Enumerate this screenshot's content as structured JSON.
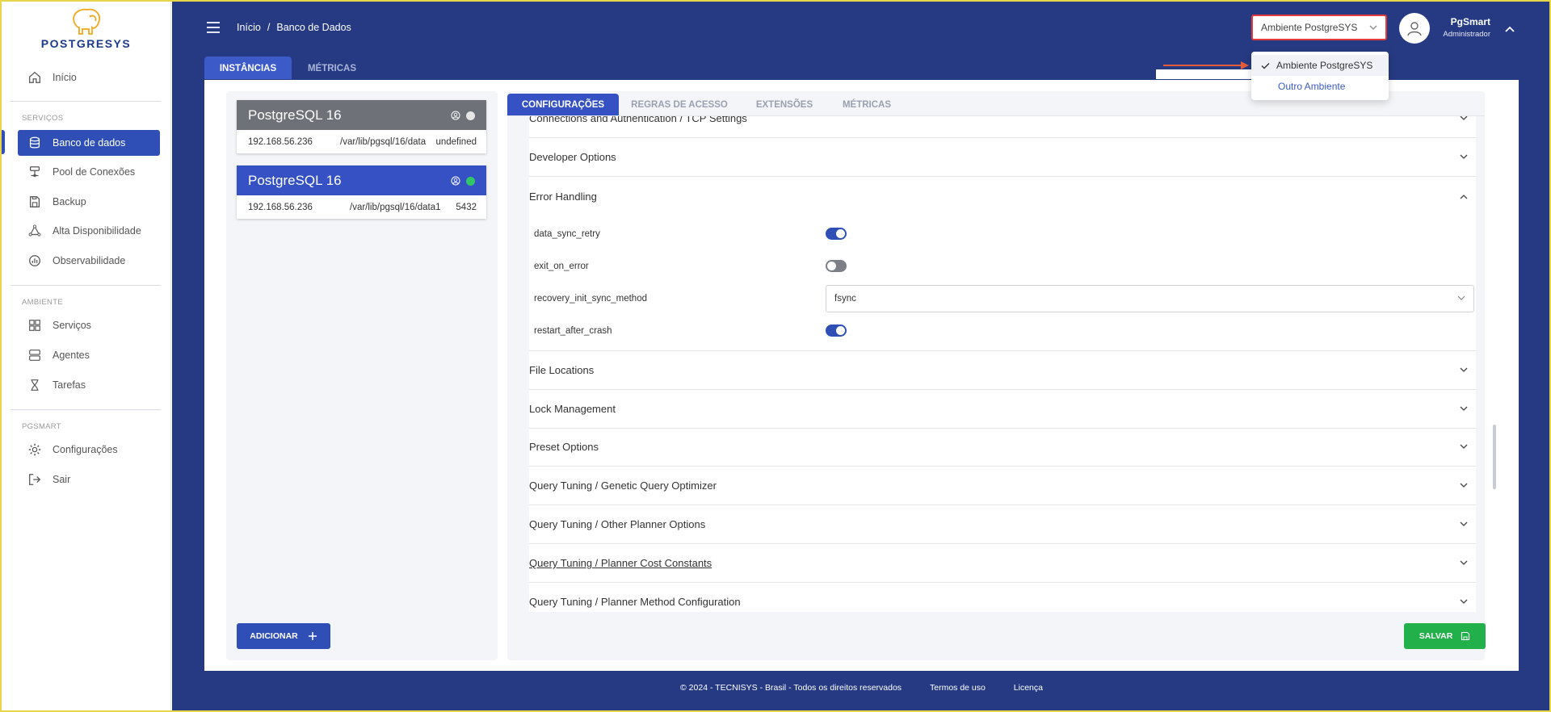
{
  "brand": {
    "name": "POSTGRESYS"
  },
  "sidebar": {
    "items": [
      {
        "label": "Início"
      },
      {
        "label": "Banco de dados"
      },
      {
        "label": "Pool de Conexões"
      },
      {
        "label": "Backup"
      },
      {
        "label": "Alta Disponibilidade"
      },
      {
        "label": "Observabilidade"
      },
      {
        "label": "Serviços"
      },
      {
        "label": "Agentes"
      },
      {
        "label": "Tarefas"
      },
      {
        "label": "Configurações"
      },
      {
        "label": "Sair"
      }
    ],
    "sections": [
      "SERVIÇOS",
      "AMBIENTE",
      "PGSMART"
    ]
  },
  "breadcrumb": {
    "home": "Início",
    "separator": "/",
    "current": "Banco de Dados"
  },
  "top_tabs": [
    {
      "label": "INSTÂNCIAS"
    },
    {
      "label": "MÉTRICAS"
    }
  ],
  "environment": {
    "selected": "Ambiente PostgreSYS",
    "options": [
      "Ambiente PostgreSYS",
      "Outro Ambiente"
    ]
  },
  "user": {
    "name": "PgSmart",
    "role": "Administrador"
  },
  "instances": [
    {
      "title": "PostgreSQL 16",
      "ip": "192.168.56.236",
      "path": "/var/lib/pgsql/16/data",
      "port": "undefined",
      "status_color": "#e6e6e6",
      "header_color": "#6e7178"
    },
    {
      "title": "PostgreSQL 16",
      "ip": "192.168.56.236",
      "path": "/var/lib/pgsql/16/data1",
      "port": "5432",
      "status_color": "#32c766",
      "header_color": "#3551c4"
    }
  ],
  "add_button": {
    "label": "ADICIONAR"
  },
  "config_tabs": [
    {
      "label": "CONFIGURAÇÕES"
    },
    {
      "label": "REGRAS DE ACESSO"
    },
    {
      "label": "EXTENSÕES"
    },
    {
      "label": "MÉTRICAS"
    }
  ],
  "sections": [
    {
      "label": "Connections and Authentication / TCP Settings"
    },
    {
      "label": "Developer Options"
    },
    {
      "label": "Error Handling"
    },
    {
      "label": "File Locations"
    },
    {
      "label": "Lock Management"
    },
    {
      "label": "Preset Options"
    },
    {
      "label": "Query Tuning / Genetic Query Optimizer"
    },
    {
      "label": "Query Tuning / Other Planner Options"
    },
    {
      "label": "Query Tuning / Planner Cost Constants"
    },
    {
      "label": "Query Tuning / Planner Method Configuration"
    }
  ],
  "error_handling": {
    "data_sync_retry": {
      "label": "data_sync_retry",
      "value": true
    },
    "exit_on_error": {
      "label": "exit_on_error",
      "value": false
    },
    "recovery_init_sync_method": {
      "label": "recovery_init_sync_method",
      "value": "fsync"
    },
    "restart_after_crash": {
      "label": "restart_after_crash",
      "value": true
    }
  },
  "save_button": {
    "label": "SALVAR"
  },
  "footer": {
    "copyright": "© 2024 - TECNISYS - Brasil - Todos os direitos reservados",
    "terms": "Termos de uso",
    "license": "Licença"
  },
  "colors": {
    "primary": "#263a83",
    "accent": "#2f4fb7",
    "success": "#22b04b",
    "highlight_border": "#e23b3b"
  }
}
